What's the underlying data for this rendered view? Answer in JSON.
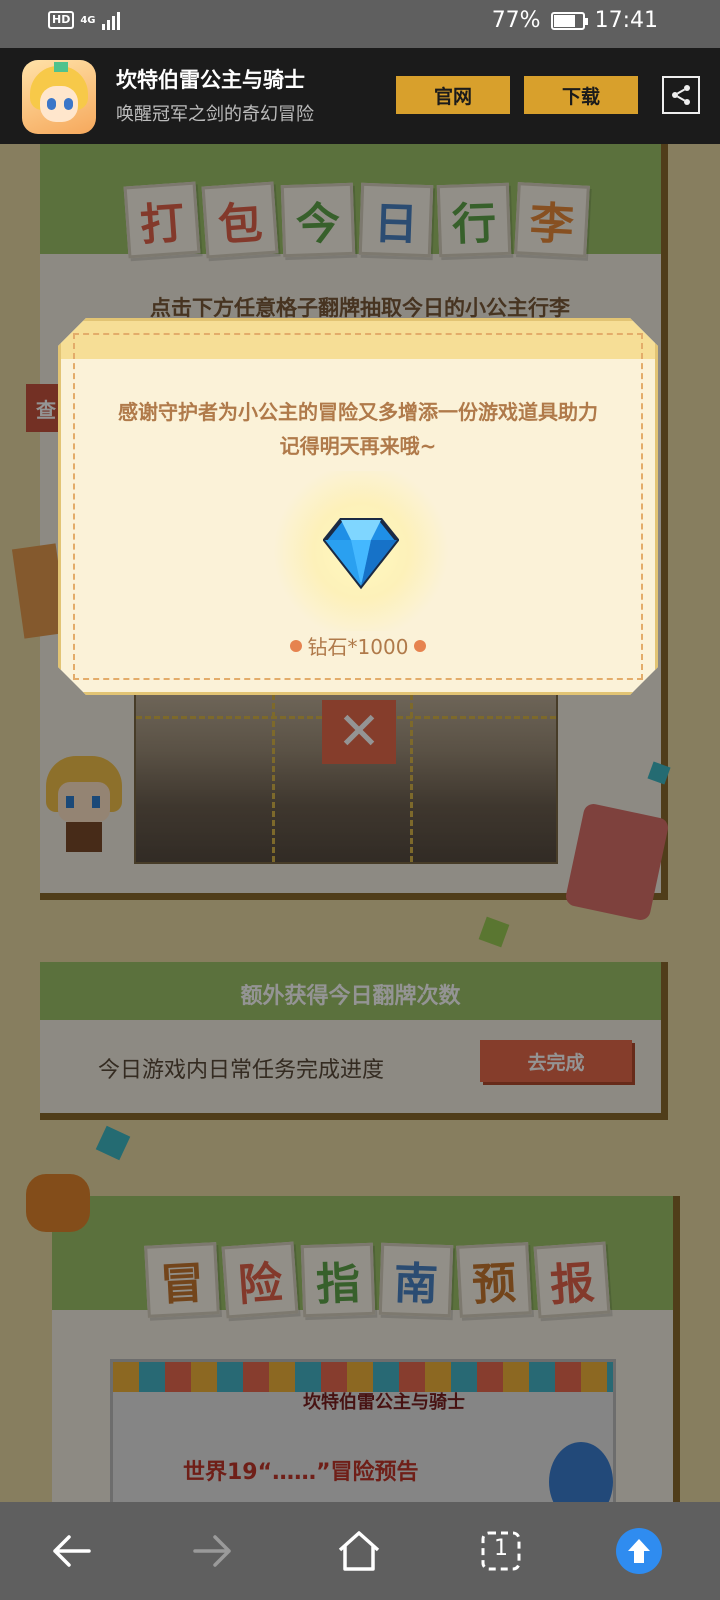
{
  "status_bar": {
    "network_badge": "HD",
    "network_type": "4G",
    "battery_percent": "77%",
    "battery_level": 0.77,
    "time": "17:41"
  },
  "app_banner": {
    "title": "坎特伯雷公主与骑士",
    "subtitle": "唤醒冠军之剑的奇幻冒险",
    "official_site_label": "官网",
    "download_label": "下载",
    "accent_color": "#d8a02c"
  },
  "packing_section": {
    "title_chars": [
      "打",
      "包",
      "今",
      "日",
      "行",
      "李"
    ],
    "instruction": "点击下方任意格子翻牌抽取今日的小公主行李",
    "side_tab": "查"
  },
  "extra_flips": {
    "title": "额外获得今日翻牌次数",
    "row_label": "今日游戏内日常任务完成进度",
    "go_button_label": "去完成"
  },
  "guide_section": {
    "title_chars": [
      "冒",
      "险",
      "指",
      "南",
      "预",
      "报"
    ],
    "banner_logo": "坎特伯雷公主与骑士",
    "banner_text": "世界19“……”冒险预告"
  },
  "reward_modal": {
    "message_line1": "感谢守护者为小公主的冒险又多增添一份游戏道具助力",
    "message_line2": "记得明天再来哦~",
    "reward_label": "钻石*1000",
    "reward_icon": "diamond-icon"
  },
  "nav_bar": {
    "tab_count": "1",
    "icons": [
      "back-arrow-icon",
      "forward-arrow-icon",
      "home-icon",
      "tabs-icon",
      "scroll-top-icon"
    ]
  }
}
